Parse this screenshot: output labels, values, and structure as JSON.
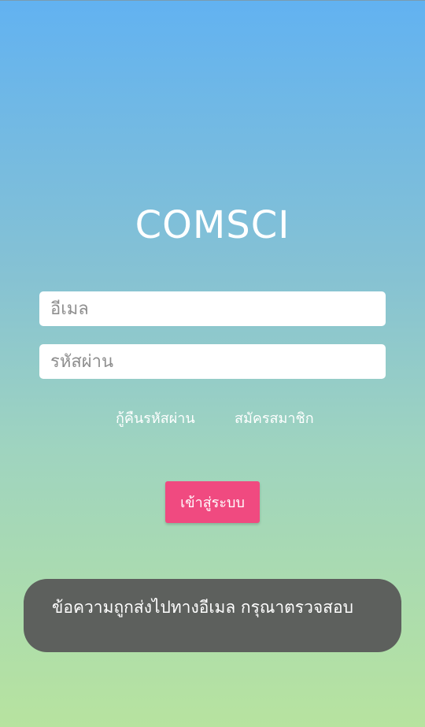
{
  "app": {
    "logo_text": "COMSCI"
  },
  "form": {
    "email_placeholder": "อีเมล",
    "email_value": "",
    "password_placeholder": "รหัสผ่าน",
    "password_value": ""
  },
  "links": {
    "recover_password": "กู้คืนรหัสผ่าน",
    "register": "สมัครสมาชิก"
  },
  "actions": {
    "login_label": "เข้าสู่ระบบ"
  },
  "toast": {
    "message": "ข้อความถูกส่งไปทางอีเมล กรุณาตรวจสอบ"
  },
  "colors": {
    "gradient_top": "#62b2f1",
    "gradient_bottom": "#b7e39f",
    "login_button": "#f04a80",
    "toast_background": "#5d605d"
  }
}
